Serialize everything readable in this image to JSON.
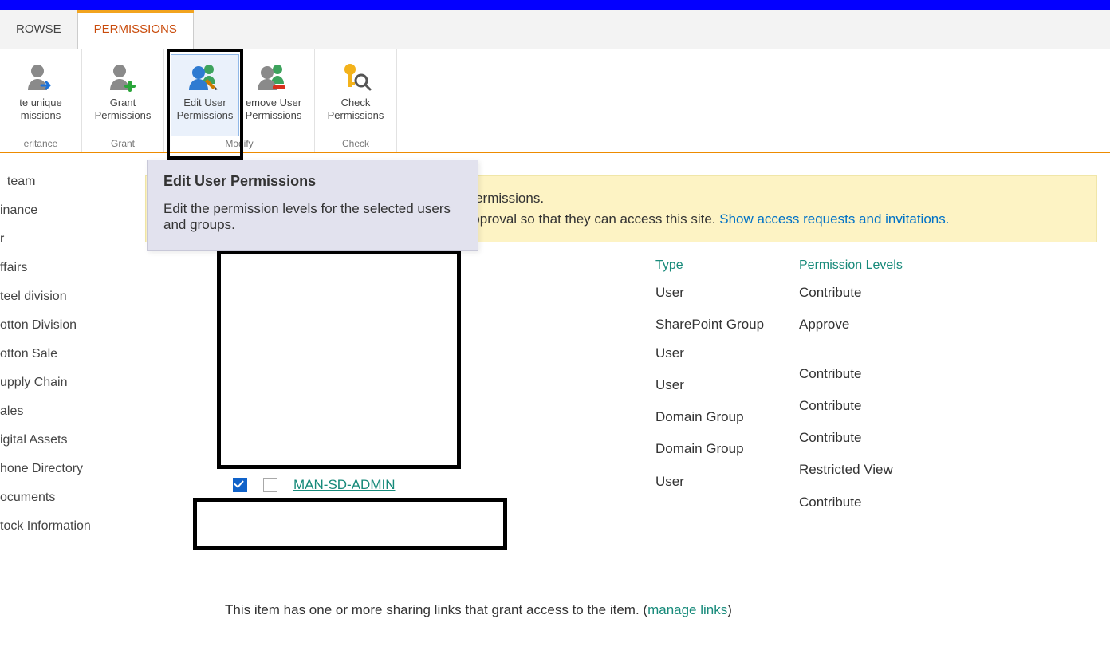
{
  "tabs": {
    "browse": "ROWSE",
    "permissions": "PERMISSIONS"
  },
  "ribbon": {
    "inheritance": {
      "label": "eritance",
      "delete": {
        "l1": "te unique",
        "l2": "missions"
      }
    },
    "grant": {
      "label": "Grant",
      "grant": {
        "l1": "Grant",
        "l2": "Permissions"
      }
    },
    "modify": {
      "label": "Modify",
      "edit": {
        "l1": "Edit User",
        "l2": "Permissions"
      },
      "remove": {
        "l1": "emove User",
        "l2": "Permissions"
      }
    },
    "check": {
      "label": "Check",
      "check": {
        "l1": "Check",
        "l2": "Permissions"
      }
    }
  },
  "tooltip": {
    "title": "Edit User Permissions",
    "body": "Edit the permission levels for the selected users and groups."
  },
  "notice": {
    "line1_tail": "ue permissions.",
    "line2_tail": "ur approval so that they can access this site. ",
    "link": "Show access requests and invitations."
  },
  "sidebar": {
    "items": [
      "_team",
      "inance",
      "r",
      "ffairs",
      "teel division",
      "otton Division",
      "otton Sale",
      "upply Chain",
      "ales",
      "igital Assets",
      "hone Directory",
      "ocuments",
      "tock Information"
    ]
  },
  "table": {
    "headers": {
      "type": "Type",
      "perm": "Permission Levels"
    },
    "rows": [
      {
        "type": "User",
        "perm": "Contribute"
      },
      {
        "type": "SharePoint Group",
        "perm": "Approve"
      },
      {
        "type": "User",
        "perm": "Contribute"
      },
      {
        "type": "User",
        "perm": "Contribute"
      },
      {
        "type": "Domain Group",
        "perm": "Contribute"
      },
      {
        "type": "Domain Group",
        "perm": "Restricted View"
      },
      {
        "type": "User",
        "perm": "Contribute"
      }
    ],
    "named_row": "MAN-SD-ADMIN"
  },
  "sharing": {
    "text_pre": "This item has one or more sharing links that grant access to the item. (",
    "link": "manage links",
    "text_post": ")"
  }
}
